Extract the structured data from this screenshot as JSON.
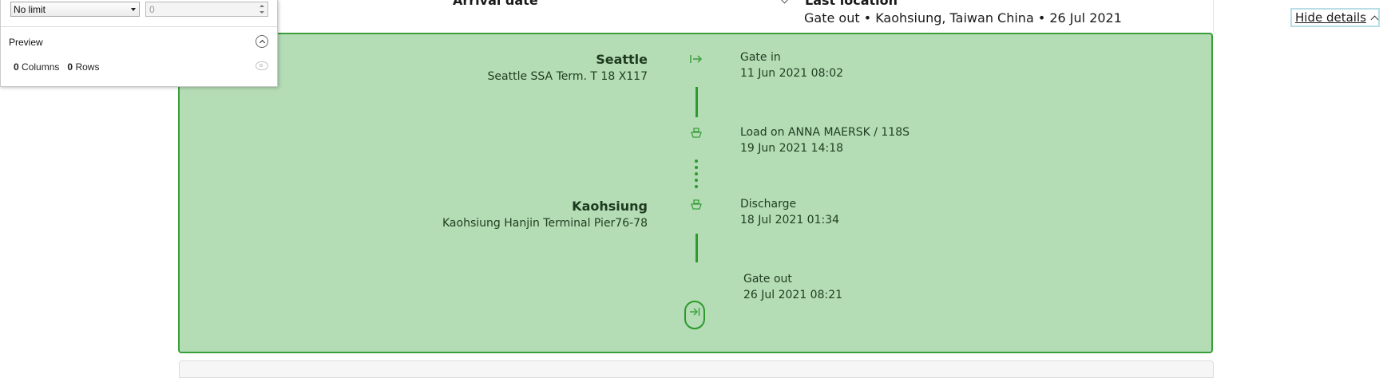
{
  "header": {
    "left_column_title": "Arrival date",
    "right_column_title": "Last location",
    "last_location": "Gate out • Kaohsiung, Taiwan China • 26 Jul 2021",
    "hide_details_label": "Hide details"
  },
  "timeline": {
    "locations": [
      {
        "city": "Seattle",
        "terminal": "Seattle SSA Term. T 18 X117"
      },
      {
        "city": "Kaohsiung",
        "terminal": "Kaohsiung Hanjin Terminal Pier76-78"
      }
    ],
    "events": [
      {
        "label": "Gate in",
        "date": "11 Jun 2021 08:02",
        "icon": "gate-in-icon"
      },
      {
        "label": "Load on ANNA MAERSK / 118S",
        "date": "19 Jun 2021 14:18",
        "icon": "vessel-icon"
      },
      {
        "label": "Discharge",
        "date": "18 Jul 2021 01:34",
        "icon": "vessel-icon"
      },
      {
        "label": "Gate out",
        "date": "26 Jul 2021 08:21",
        "icon": "gate-out-icon"
      }
    ]
  },
  "dialog": {
    "limit_select": "No limit",
    "limit_value": "0",
    "preview_title": "Preview",
    "columns_count": "0",
    "columns_label": "Columns",
    "rows_count": "0",
    "rows_label": "Rows"
  },
  "colors": {
    "panel_bg": "#b4dcb5",
    "accent_green": "#2e9a2e",
    "focus_outline": "#b8dde6"
  }
}
